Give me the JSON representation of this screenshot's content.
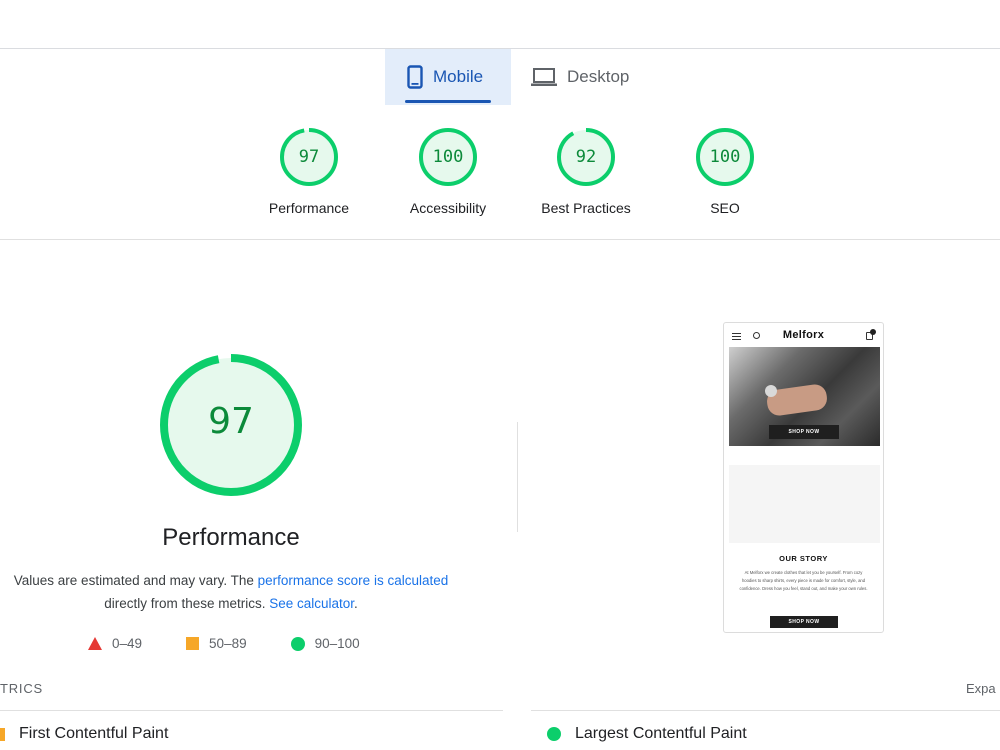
{
  "tabs": {
    "mobile": "Mobile",
    "desktop": "Desktop",
    "selected": "mobile"
  },
  "categories": [
    {
      "score": 97,
      "label": "Performance"
    },
    {
      "score": 100,
      "label": "Accessibility"
    },
    {
      "score": 92,
      "label": "Best Practices"
    },
    {
      "score": 100,
      "label": "SEO"
    }
  ],
  "performance": {
    "score": 97,
    "title": "Performance",
    "desc_before": "Values are estimated and may vary. The ",
    "desc_link1": "performance score is calculated",
    "desc_middle": "directly from these metrics. ",
    "desc_link2": "See calculator",
    "desc_end": "."
  },
  "legend": {
    "fail": "0–49",
    "average": "50–89",
    "pass": "90–100"
  },
  "colors": {
    "pass": "#0cce6b",
    "pass_text": "#0c8a3a",
    "average": "#f6a728",
    "fail": "#e53935",
    "accent": "#1a73e8"
  },
  "screenshot": {
    "brand": "Melforx",
    "hero_button": "SHOP NOW",
    "story_title": "OUR STORY",
    "story_text": "At Melforx we create clothes that let you be yourself. From cozy hoodies to sharp shirts, every piece is made for comfort, style, and confidence. Dress how you feel, stand out, and make your own rules.",
    "bottom_button": "SHOP NOW"
  },
  "metrics": {
    "section_label": "TRICS",
    "expand_label": "Expa",
    "items": [
      {
        "label": "First Contentful Paint",
        "status": "average"
      },
      {
        "label": "Largest Contentful Paint",
        "status": "pass"
      }
    ]
  }
}
